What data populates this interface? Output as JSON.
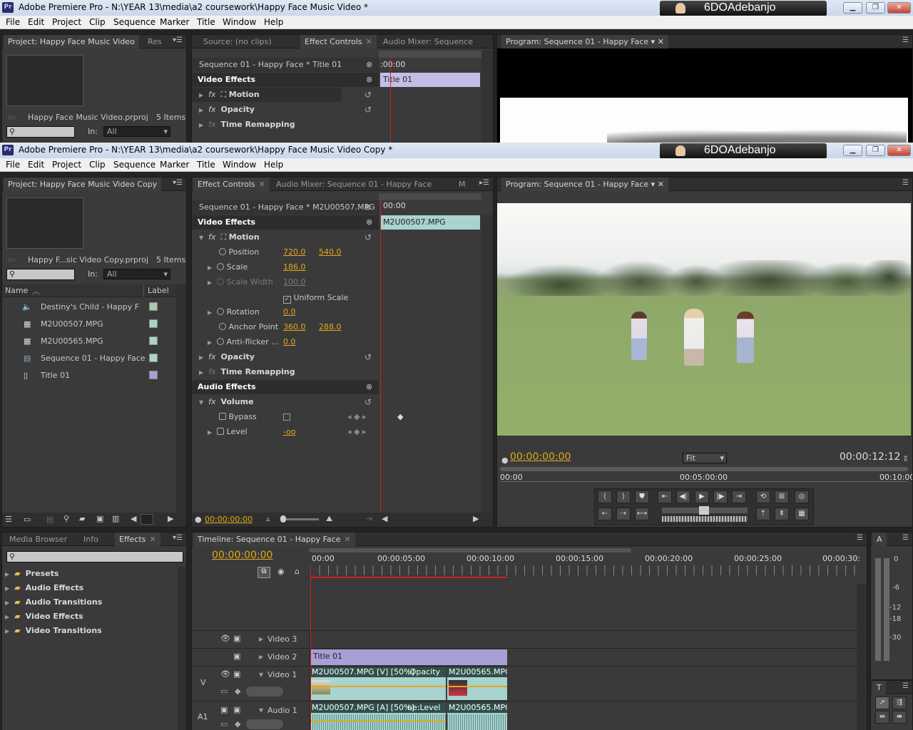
{
  "colors": {
    "accent": "#e3a91a",
    "playhead": "#d02020",
    "clip_video": "#a8d3cf",
    "clip_title": "#a89fd6",
    "panel": "#3a3a3a"
  },
  "win1": {
    "title": "Adobe Premiere Pro - N:\\YEAR 13\\media\\a2 coursework\\Happy Face Music Video *",
    "user": "6DOAdebanjo",
    "menu": [
      "File",
      "Edit",
      "Project",
      "Clip",
      "Sequence",
      "Marker",
      "Title",
      "Window",
      "Help"
    ],
    "project_tab": "Project: Happy Face Music Video",
    "project_tab2": "Res",
    "project_file": "Happy Face Music Video.prproj",
    "items": "5 Items",
    "in_label": "In:",
    "in_value": "All",
    "source_tab": "Source: (no clips)",
    "effect_tab": "Effect Controls",
    "mixer_tab": "Audio Mixer: Sequence",
    "seq_label": "Sequence 01 - Happy Face * Title 01",
    "time_start": ":00:00",
    "clip_label": "Title 01",
    "video_effects": "Video Effects",
    "motion": "Motion",
    "opacity": "Opacity",
    "time_remap": "Time Remapping",
    "program_tab": "Program: Sequence 01 - Happy Face"
  },
  "win2": {
    "title": "Adobe Premiere Pro - N:\\YEAR 13\\media\\a2 coursework\\Happy Face Music Video Copy *",
    "user": "6DOAdebanjo",
    "menu": [
      "File",
      "Edit",
      "Project",
      "Clip",
      "Sequence",
      "Marker",
      "Title",
      "Window",
      "Help"
    ],
    "project_tab": "Project: Happy Face Music Video Copy",
    "project_file": "Happy F...sic Video Copy.prproj",
    "items": "5 Items",
    "in_label": "In:",
    "in_value": "All",
    "col_name": "Name",
    "col_label": "Label",
    "project_items": [
      {
        "name": "Destiny's Child - Happy F",
        "icon": "audio",
        "color": "#a8c8b0"
      },
      {
        "name": "M2U00507.MPG",
        "icon": "film",
        "color": "#a8d3cf"
      },
      {
        "name": "M2U00565.MPG",
        "icon": "film",
        "color": "#a8d3cf"
      },
      {
        "name": "Sequence 01 - Happy Face",
        "icon": "sequence",
        "color": "#a8d3cf"
      },
      {
        "name": "Title 01",
        "icon": "title",
        "color": "#a89fd6"
      }
    ],
    "effect_tab": "Effect Controls",
    "mixer_tab": "Audio Mixer: Sequence 01 - Happy Face",
    "metadata_tab": "M",
    "seq_label": "Sequence 01 - Happy Face * M2U00507.MPG",
    "time_start": "00:00",
    "clip_label": "M2U00507.MPG",
    "video_effects": "Video Effects",
    "motion": "Motion",
    "position": {
      "label": "Position",
      "x": "720.0",
      "y": "540.0"
    },
    "scale": {
      "label": "Scale",
      "v": "186.0"
    },
    "scale_width": {
      "label": "Scale Width",
      "v": "100.0"
    },
    "uniform": "Uniform Scale",
    "rotation": {
      "label": "Rotation",
      "v": "0.0"
    },
    "anchor": {
      "label": "Anchor Point",
      "x": "360.0",
      "y": "288.0"
    },
    "antiflicker": {
      "label": "Anti-flicker ...",
      "v": "0.0"
    },
    "opacity": "Opacity",
    "time_remap": "Time Remapping",
    "audio_effects": "Audio Effects",
    "volume": "Volume",
    "bypass": "Bypass",
    "level": {
      "label": "Level",
      "v": "-oo"
    },
    "ec_time": "00:00:00:00",
    "program_tab": "Program: Sequence 01 - Happy Face",
    "prog_time": "00:00:00:00",
    "prog_fit": "Fit",
    "prog_duration": "00:00:12:12",
    "prog_ruler": [
      "00:00",
      "00:05:00:00",
      "00:10:00"
    ]
  },
  "bottom": {
    "tabs": [
      "Media Browser",
      "Info",
      "Effects"
    ],
    "effects_folders": [
      "Presets",
      "Audio Effects",
      "Audio Transitions",
      "Video Effects",
      "Video Transitions"
    ],
    "timeline_tab": "Timeline: Sequence 01 - Happy Face",
    "tl_time": "00:00:00:00",
    "tl_ruler": [
      "00:00",
      "00:00:05:00",
      "00:00:10:00",
      "00:00:15:00",
      "00:00:20:00",
      "00:00:25:00",
      "00:00:30:"
    ],
    "tracks": {
      "v3": "Video 3",
      "v2": "Video 2",
      "v1": "Video 1",
      "a1": "Audio 1",
      "v_tag": "V",
      "a_tag": "A1"
    },
    "clips": {
      "title": "Title 01",
      "v1a": "M2U00507.MPG [V] [50%]",
      "v1a_fx": ":Opacity",
      "v1b": "M2U00565.MPG",
      "a1a": "M2U00507.MPG [A] [50%]",
      "a1a_fx": "ne:Level",
      "a1b": "M2U00565.MPG"
    },
    "meter": [
      "0",
      "-6",
      "-12",
      "-18",
      "-30"
    ],
    "meter_tab": "A",
    "tools_tab": "T"
  }
}
